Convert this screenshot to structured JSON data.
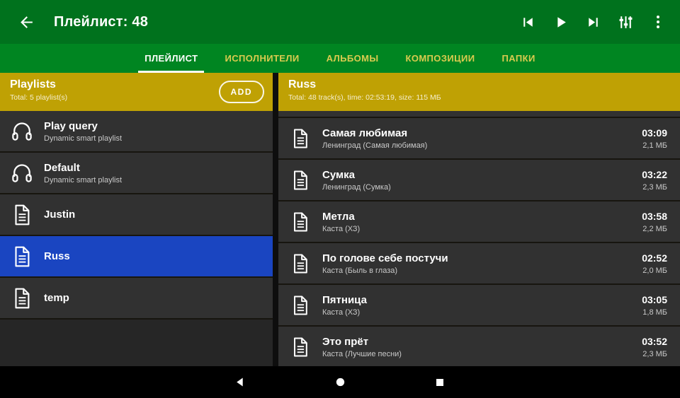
{
  "app_bar": {
    "title": "Плейлист: 48"
  },
  "tabs": [
    {
      "label": "ПЛЕЙЛИСТ",
      "active": true
    },
    {
      "label": "ИСПОЛНИТЕЛИ",
      "active": false
    },
    {
      "label": "АЛЬБОМЫ",
      "active": false
    },
    {
      "label": "КОМПОЗИЦИИ",
      "active": false
    },
    {
      "label": "ПАПКИ",
      "active": false
    }
  ],
  "left_panel": {
    "header": {
      "title": "Playlists",
      "subtitle": "Total: 5 playlist(s)",
      "add_label": "ADD"
    },
    "items": [
      {
        "title": "Play query",
        "subtitle": "Dynamic smart playlist",
        "icon": "headphones-icon",
        "selected": false
      },
      {
        "title": "Default",
        "subtitle": "Dynamic smart playlist",
        "icon": "headphones-icon",
        "selected": false
      },
      {
        "title": "Justin",
        "subtitle": "",
        "icon": "file-icon",
        "selected": false
      },
      {
        "title": "Russ",
        "subtitle": "",
        "icon": "file-icon",
        "selected": true
      },
      {
        "title": "temp",
        "subtitle": "",
        "icon": "file-icon",
        "selected": false
      }
    ]
  },
  "right_panel": {
    "header": {
      "title": "Russ",
      "subtitle": "Total: 48 track(s), time: 02:53:19, size: 115 МБ"
    },
    "tracks": [
      {
        "title": "Самая любимая",
        "subtitle": "Ленинград (Самая любимая)",
        "duration": "03:09",
        "size": "2,1 МБ"
      },
      {
        "title": "Сумка",
        "subtitle": "Ленинград (Сумка)",
        "duration": "03:22",
        "size": "2,3 МБ"
      },
      {
        "title": "Метла",
        "subtitle": "Каста (ХЗ)",
        "duration": "03:58",
        "size": "2,2 МБ"
      },
      {
        "title": "По голове себе постучи",
        "subtitle": "Каста (Быль в глаза)",
        "duration": "02:52",
        "size": "2,0 МБ"
      },
      {
        "title": "Пятница",
        "subtitle": "Каста (ХЗ)",
        "duration": "03:05",
        "size": "1,8 МБ"
      },
      {
        "title": "Это прёт",
        "subtitle": "Каста (Лучшие песни)",
        "duration": "03:52",
        "size": "2,3 МБ"
      }
    ]
  },
  "nav_bar": {
    "buttons": [
      "back",
      "home",
      "recents"
    ]
  },
  "colors": {
    "app_bar_green": "#00721d",
    "tab_bar_green": "#008521",
    "header_gold": "#bfa104",
    "selected_blue": "#1a45c1",
    "row_bg": "#313131",
    "inactive_tab_yellow": "#d9cb4f"
  }
}
